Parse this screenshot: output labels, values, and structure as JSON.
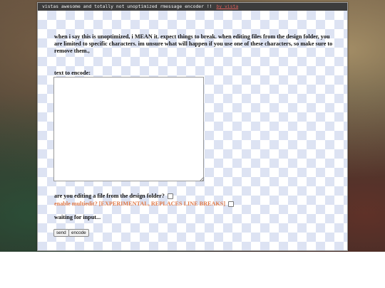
{
  "window": {
    "title": "vistas awesome and totally not unoptimized rmessage encoder !!",
    "title_link": "by vista"
  },
  "main": {
    "warning": "when i say this is unoptimized, i MEAN it. expect things to break. when editing files from the design folder, you are limited to specific characters. im unsure what will happen if you use one of these characters, so make sure to remove them.,",
    "input_label": "text to encode:",
    "textarea_value": "",
    "design_folder_label": "are you editing a file from the design folder?",
    "design_folder_checked": false,
    "multiedit_label": "enable multiedit? [EXPERIMENTAL, REPLACES LINE BREAKS]",
    "multiedit_checked": false,
    "status": "waiting for input...",
    "send_label": "send",
    "encode_label": "encode"
  },
  "colors": {
    "checker": "#dde3f3",
    "warning_orange": "#e07b4a",
    "titlebar": "#3c3c3c"
  }
}
